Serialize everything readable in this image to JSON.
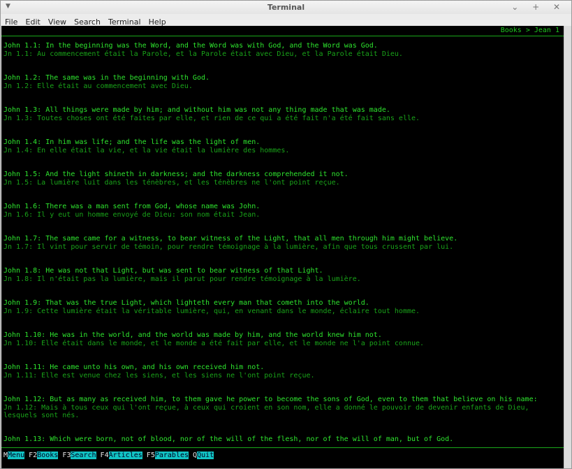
{
  "window": {
    "title": "Terminal",
    "controls": "⌄ + ✕"
  },
  "menubar": [
    "File",
    "Edit",
    "View",
    "Search",
    "Terminal",
    "Help"
  ],
  "breadcrumb": "Books > Jean 1",
  "verses": [
    {
      "en": "John 1.1: In the beginning was the Word, and the Word was with God, and the Word was God.",
      "fr": "Jn 1.1: Au commencement était la Parole, et la Parole était avec Dieu, et la Parole était Dieu."
    },
    {
      "en": "John 1.2: The same was in the beginning with God.",
      "fr": "Jn 1.2: Elle était au commencement avec Dieu."
    },
    {
      "en": "John 1.3: All things were made by him; and without him was not any thing made that was made.",
      "fr": "Jn 1.3: Toutes choses ont été faites par elle, et rien de ce qui a été fait n'a été fait sans elle."
    },
    {
      "en": "John 1.4: In him was life; and the life was the light of men.",
      "fr": "Jn 1.4: En elle était la vie, et la vie était la lumière des hommes."
    },
    {
      "en": "John 1.5: And the light shineth in darkness; and the darkness comprehended it not.",
      "fr": "Jn 1.5: La lumière luit dans les ténèbres, et les ténèbres ne l'ont point reçue."
    },
    {
      "en": "John 1.6: There was a man sent from God, whose name was John.",
      "fr": "Jn 1.6: Il y eut un homme envoyé de Dieu: son nom était Jean."
    },
    {
      "en": "John 1.7: The same came for a witness, to bear witness of the Light, that all men through him might believe.",
      "fr": "Jn 1.7: Il vint pour servir de témoin, pour rendre témoignage à la lumière, afin que tous crussent par lui."
    },
    {
      "en": "John 1.8: He was not that Light, but was sent to bear witness of that Light.",
      "fr": "Jn 1.8: Il n'était pas la lumière, mais il parut pour rendre témoignage à la lumière."
    },
    {
      "en": "John 1.9: That was the true Light, which lighteth every man that cometh into the world.",
      "fr": "Jn 1.9: Cette lumière était la véritable lumière, qui, en venant dans le monde, éclaire tout homme."
    },
    {
      "en": "John 1.10: He was in the world, and the world was made by him, and the world knew him not.",
      "fr": "Jn 1.10: Elle était dans le monde, et le monde a été fait par elle, et le monde ne l'a point connue."
    },
    {
      "en": "John 1.11: He came unto his own, and his own received him not.",
      "fr": "Jn 1.11: Elle est venue chez les siens, et les siens ne l'ont point reçue."
    },
    {
      "en": "John 1.12: But as many as received him, to them gave he power to become the sons of God, even to them that believe on his name:",
      "fr": "Jn 1.12: Mais à tous ceux qui l'ont reçue, à ceux qui croient en son nom, elle a donné le pouvoir de devenir enfants de Dieu, lesquels sont nés."
    },
    {
      "en": "John 1.13: Which were born, not of blood, nor of the will of the flesh, nor of the will of man, but of God.",
      "fr": ""
    }
  ],
  "function_keys": [
    {
      "key": "M",
      "label": "Menu"
    },
    {
      "key": "F2",
      "label": "Books"
    },
    {
      "key": "F3",
      "label": "Search"
    },
    {
      "key": "F4",
      "label": "Articles"
    },
    {
      "key": "F5",
      "label": "Parables"
    },
    {
      "key": "Q",
      "label": "Quit"
    }
  ],
  "colors": {
    "verse_en": "#2ee52e",
    "verse_fr": "#19a319",
    "fkey_label_bg": "#11c4c4",
    "terminal_bg": "#000000"
  }
}
